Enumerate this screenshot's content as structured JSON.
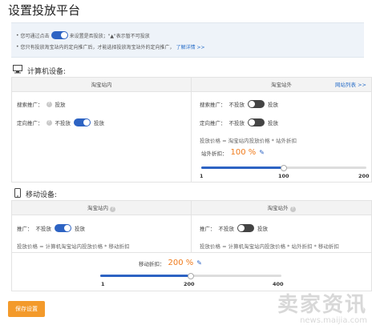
{
  "page": {
    "title": "设置投放平台"
  },
  "notice": {
    "line1_prefix": "您可通过点击",
    "line1_suffix": "来设置是否投放；\"▲\"表示暂不可投放",
    "line2": "您只有投放淘宝站内的定向推广后，才能选择投放淘宝站外的定向推广，",
    "line2_link": "了解详情 >>"
  },
  "computer": {
    "label": "计算机设备:",
    "icon": "monitor-icon",
    "inside": {
      "header": "淘宝站内",
      "search_label": "搜索推广：",
      "search_value": "投放",
      "target_label": "定向推广：",
      "target_off": "不投放",
      "target_on": "投放"
    },
    "outside": {
      "header": "淘宝站外",
      "list_link": "网站列表 >>",
      "search_label": "搜索推广：",
      "search_off": "不投放",
      "search_on": "投放",
      "target_label": "定向推广：",
      "target_off": "不投放",
      "target_on": "投放",
      "formula": "投放价格 = 淘宝站内投放价格 * 站外折扣",
      "discount_label": "站外折扣：",
      "discount_value": "100 %",
      "ticks": [
        "1",
        "100",
        "200"
      ],
      "slider_fraction": 0.5
    }
  },
  "mobile": {
    "label": "移动设备:",
    "icon": "mobile-icon",
    "inside": {
      "header": "淘宝站内",
      "promo_label": "推广：",
      "promo_off": "不投放",
      "promo_on": "投放",
      "formula": "投放价格 = 计算机淘宝站内投放价格 * 移动折扣"
    },
    "outside": {
      "header": "淘宝站外",
      "promo_label": "推广：",
      "promo_off": "不投放",
      "promo_on": "投放",
      "formula": "投放价格 = 计算机淘宝站内投放价格 * 站外折扣 * 移动折扣"
    },
    "discount_label": "移动折扣：",
    "discount_value": "200 %",
    "ticks": [
      "1",
      "200",
      "400"
    ],
    "slider_fraction": 0.5
  },
  "actions": {
    "save_label": "保存设置"
  },
  "watermark": {
    "main": "卖家资讯",
    "sub": "news.maijia.com"
  },
  "colors": {
    "accent": "#2d63c3",
    "orange": "#f07a1a",
    "button": "#f39a2b"
  }
}
